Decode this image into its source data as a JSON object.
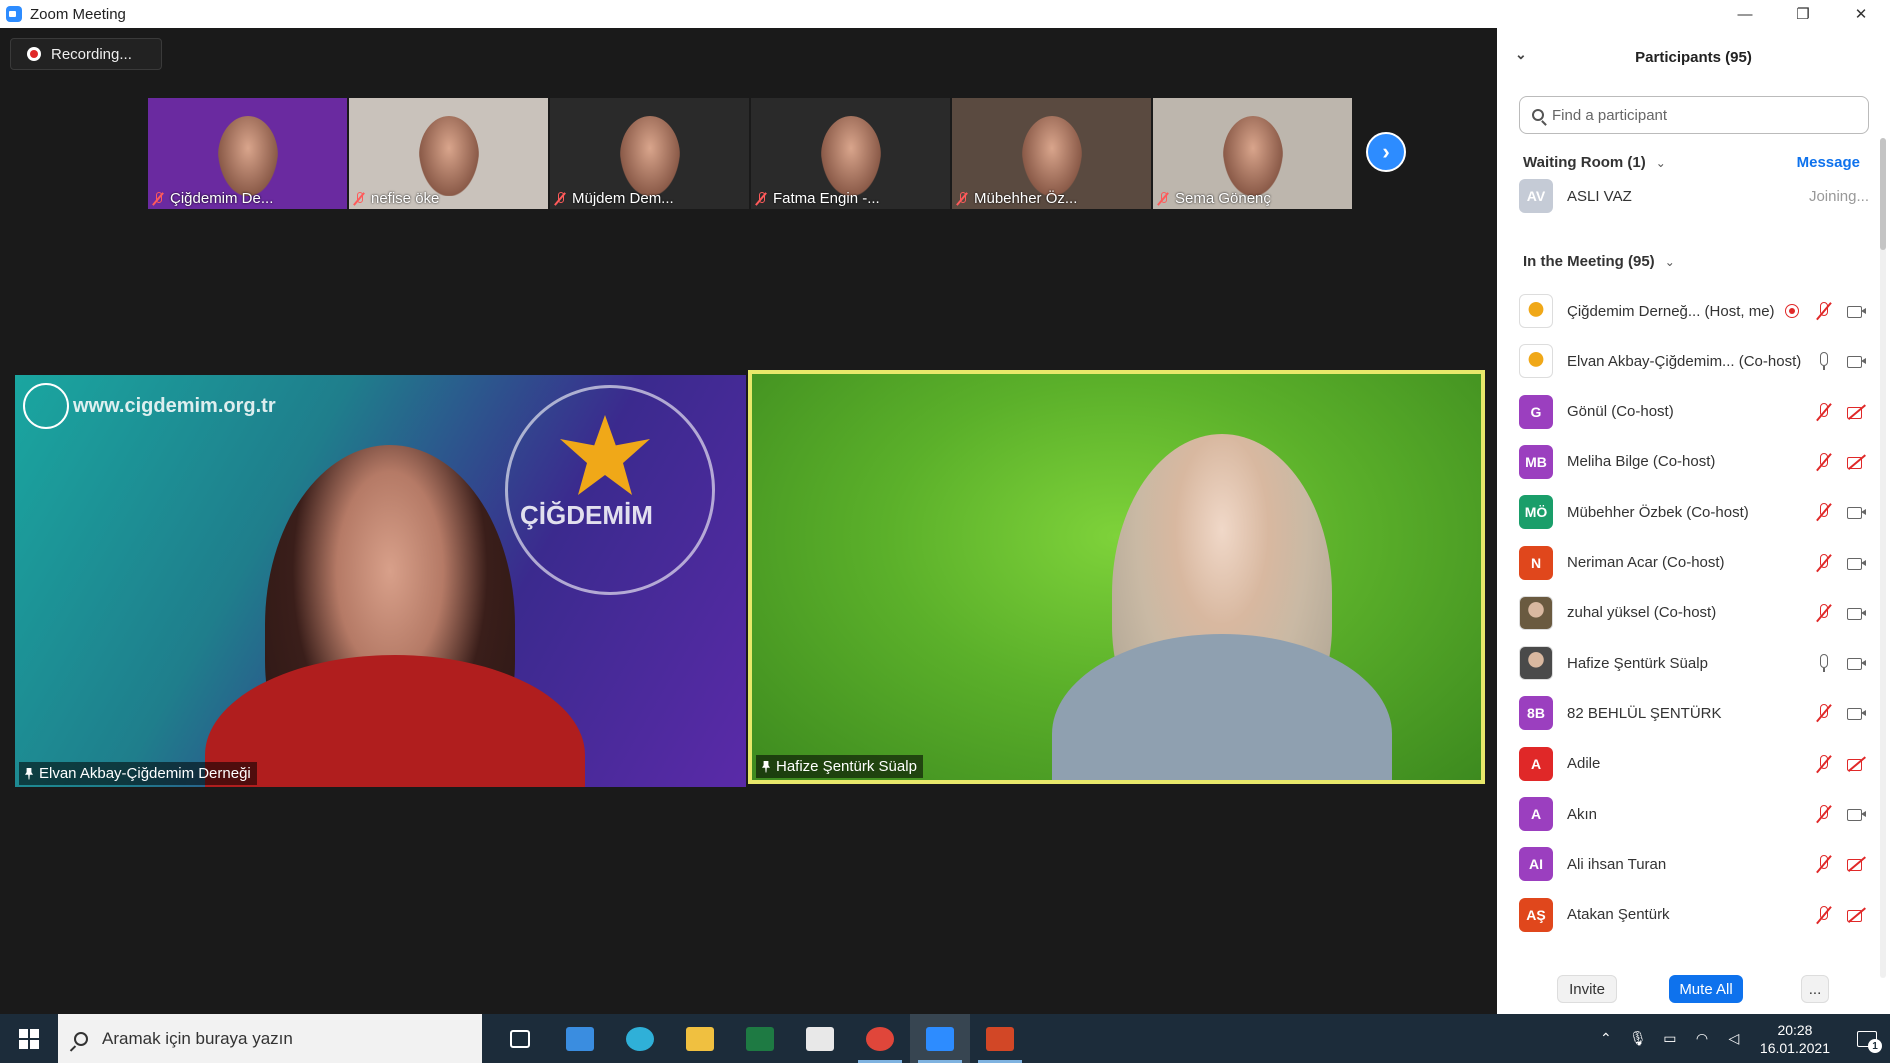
{
  "window": {
    "title": "Zoom Meeting",
    "minimize": "—",
    "restore": "❐",
    "close": "✕"
  },
  "recording": {
    "label": "Recording..."
  },
  "thumbnails": [
    {
      "name": "Çiğdemim De...",
      "bg": "#6a2aa0"
    },
    {
      "name": "nefise öke",
      "bg": "#c9c2bb"
    },
    {
      "name": "Müjdem Dem...",
      "bg": "#2a2a2a"
    },
    {
      "name": "Fatma Engin -...",
      "bg": "#2a2a2a"
    },
    {
      "name": "Mübehher Öz...",
      "bg": "#5a4a40"
    },
    {
      "name": "Sema Gönenç",
      "bg": "#bdb6ad"
    }
  ],
  "next_arrow_icon": "chevron-right-icon",
  "main_videos": {
    "left": {
      "name": "Elvan Akbay-Çiğdemim Derneği",
      "watermark": "www.cigdemim.org.tr",
      "logo_text": "ÇİĞDEMİM"
    },
    "right": {
      "name": "Hafize Şentürk Süalp"
    }
  },
  "panel": {
    "title": "Participants (95)",
    "search_placeholder": "Find a participant",
    "waiting_room": {
      "label": "Waiting Room (1)",
      "message": "Message"
    },
    "waiting": [
      {
        "initials": "AV",
        "name": "ASLI VAZ",
        "status": "Joining...",
        "color": "#c5cbd6"
      }
    ],
    "in_meeting_label": "In the Meeting (95)",
    "participants": [
      {
        "initials": "",
        "name": "Çiğdemim Derneğ... (Host, me)",
        "color": "#ffffff",
        "img": true,
        "mic": "muted",
        "cam": "on",
        "rec": true
      },
      {
        "initials": "",
        "name": "Elvan Akbay-Çiğdemim... (Co-host)",
        "color": "#ffffff",
        "img": true,
        "mic": "on",
        "cam": "on",
        "rec": false
      },
      {
        "initials": "G",
        "name": "Gönül (Co-host)",
        "color": "#9b3fbf",
        "mic": "muted",
        "cam": "off"
      },
      {
        "initials": "MB",
        "name": "Meliha Bilge (Co-host)",
        "color": "#9b3fbf",
        "mic": "muted",
        "cam": "off"
      },
      {
        "initials": "MÖ",
        "name": "Mübehher Özbek (Co-host)",
        "color": "#1a9e6a",
        "mic": "muted",
        "cam": "on"
      },
      {
        "initials": "N",
        "name": "Neriman Acar (Co-host)",
        "color": "#e0471c",
        "mic": "muted",
        "cam": "on"
      },
      {
        "initials": "",
        "name": "zuhal yüksel (Co-host)",
        "color": "#6a5a40",
        "img": true,
        "mic": "muted",
        "cam": "on"
      },
      {
        "initials": "",
        "name": "Hafize Şentürk Süalp",
        "color": "#4a4a4a",
        "img": true,
        "mic": "on",
        "cam": "on"
      },
      {
        "initials": "8B",
        "name": "82 BEHLÜL ŞENTÜRK",
        "color": "#9b3fbf",
        "mic": "muted",
        "cam": "on"
      },
      {
        "initials": "A",
        "name": "Adile",
        "color": "#e02828",
        "mic": "muted",
        "cam": "off"
      },
      {
        "initials": "A",
        "name": "Akın",
        "color": "#9b3fbf",
        "mic": "muted",
        "cam": "on"
      },
      {
        "initials": "AI",
        "name": "Ali ihsan Turan",
        "color": "#9b3fbf",
        "mic": "muted",
        "cam": "off"
      },
      {
        "initials": "AŞ",
        "name": "Atakan Şentürk",
        "color": "#e0471c",
        "mic": "muted",
        "cam": "off"
      }
    ],
    "footer": {
      "invite": "Invite",
      "mute_all": "Mute All",
      "more": "..."
    }
  },
  "taskbar": {
    "search_placeholder": "Aramak için buraya yazın",
    "apps": [
      {
        "name": "task-view-icon",
        "color": "#ffffff"
      },
      {
        "name": "mail-icon",
        "color": "#3a8de0"
      },
      {
        "name": "edge-icon",
        "color": "#2fb0d8"
      },
      {
        "name": "file-explorer-icon",
        "color": "#f0c040"
      },
      {
        "name": "excel-icon",
        "color": "#1e7a43"
      },
      {
        "name": "store-icon",
        "color": "#e8e8e8"
      },
      {
        "name": "chrome-icon",
        "color": "#e0463a"
      },
      {
        "name": "zoom-icon",
        "color": "#2d8cff"
      },
      {
        "name": "powerpoint-icon",
        "color": "#d24726"
      }
    ],
    "time": "20:28",
    "date": "16.01.2021",
    "notification_count": "1"
  }
}
